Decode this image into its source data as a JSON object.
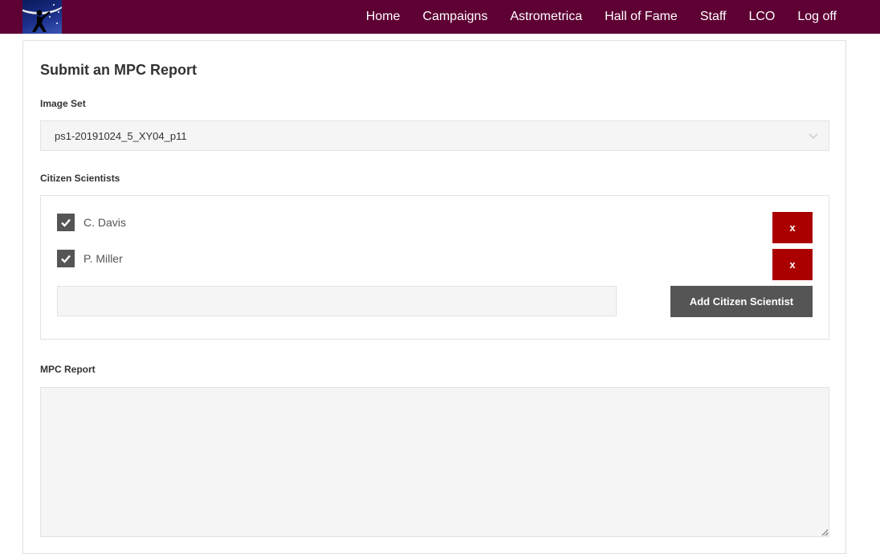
{
  "nav": {
    "items": [
      {
        "label": "Home"
      },
      {
        "label": "Campaigns"
      },
      {
        "label": "Astrometrica"
      },
      {
        "label": "Hall of Fame"
      },
      {
        "label": "Staff"
      },
      {
        "label": "LCO"
      },
      {
        "label": "Log off"
      }
    ]
  },
  "form": {
    "title": "Submit an MPC Report",
    "image_set": {
      "label": "Image Set",
      "selected": "ps1-20191024_5_XY04_p11"
    },
    "citizen_scientists": {
      "label": "Citizen Scientists",
      "items": [
        {
          "name": "C. Davis",
          "checked": true,
          "remove_label": "x"
        },
        {
          "name": "P. Miller",
          "checked": true,
          "remove_label": "x"
        }
      ],
      "input_value": "",
      "add_label": "Add Citizen Scientist"
    },
    "mpc_report": {
      "label": "MPC Report",
      "value": ""
    }
  },
  "colors": {
    "nav_bg": "#5e0033",
    "remove_button": "#aa0000",
    "dark_button": "#555555"
  }
}
